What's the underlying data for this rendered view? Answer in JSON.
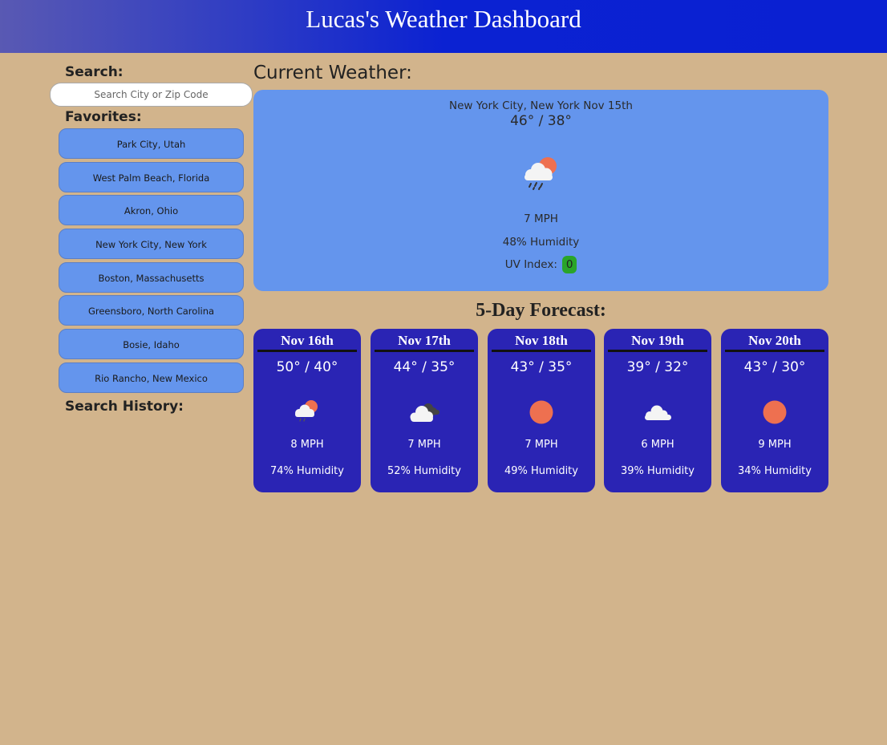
{
  "header": {
    "title": "Lucas's Weather Dashboard"
  },
  "sidebar": {
    "search_label": "Search:",
    "search_placeholder": "Search City or Zip Code",
    "search_value": "",
    "favorites_label": "Favorites:",
    "favorites": [
      "Park City, Utah",
      "West Palm Beach, Florida",
      "Akron, Ohio",
      "New York City, New York",
      "Boston, Massachusetts",
      "Greensboro, North Carolina",
      "Bosie, Idaho",
      "Rio Rancho, New Mexico"
    ],
    "history_label": "Search History:"
  },
  "current": {
    "section_title": "Current Weather:",
    "location_date": "New York City, New York Nov 15th",
    "temps": "46° / 38°",
    "icon": "cloud-sun-rain-icon",
    "wind": "7 MPH",
    "humidity": "48% Humidity",
    "uv_label": "UV Index:",
    "uv_value": "0"
  },
  "forecast": {
    "title": "5-Day Forecast:",
    "days": [
      {
        "date": "Nov 16th",
        "temps": "50° / 40°",
        "icon": "cloud-sun-rain-icon",
        "wind": "8 MPH",
        "humidity": "74% Humidity"
      },
      {
        "date": "Nov 17th",
        "temps": "44° / 35°",
        "icon": "cloud-night-icon",
        "wind": "7 MPH",
        "humidity": "52% Humidity"
      },
      {
        "date": "Nov 18th",
        "temps": "43° / 35°",
        "icon": "sun-icon",
        "wind": "7 MPH",
        "humidity": "49% Humidity"
      },
      {
        "date": "Nov 19th",
        "temps": "39° / 32°",
        "icon": "cloud-icon",
        "wind": "6 MPH",
        "humidity": "39% Humidity"
      },
      {
        "date": "Nov 20th",
        "temps": "43° / 30°",
        "icon": "sun-icon",
        "wind": "9 MPH",
        "humidity": "34% Humidity"
      }
    ]
  },
  "colors": {
    "background": "#d2b48c",
    "header_blue": "#0a20d2",
    "card_blue": "#6495ed",
    "forecast_card": "#2a24b4",
    "sun": "#ee7050",
    "uv_green": "#2aa52a"
  }
}
